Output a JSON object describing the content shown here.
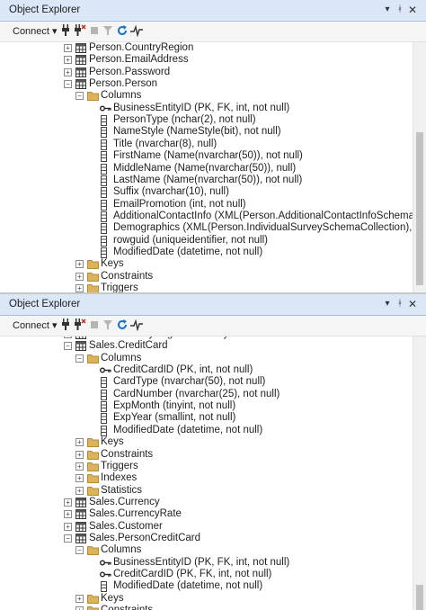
{
  "top_panel": {
    "title": "Object Explorer",
    "connect_label": "Connect",
    "tree": [
      {
        "depth": 0,
        "expander": "+",
        "icon": "table-icon",
        "label": "Person.CountryRegion"
      },
      {
        "depth": 0,
        "expander": "+",
        "icon": "table-icon",
        "label": "Person.EmailAddress"
      },
      {
        "depth": 0,
        "expander": "+",
        "icon": "table-icon",
        "label": "Person.Password"
      },
      {
        "depth": 0,
        "expander": "-",
        "icon": "table-icon",
        "label": "Person.Person"
      },
      {
        "depth": 1,
        "expander": "-",
        "icon": "folder-icon",
        "label": "Columns"
      },
      {
        "depth": 2,
        "expander": "",
        "icon": "key-icon",
        "label": "BusinessEntityID (PK, FK, int, not null)"
      },
      {
        "depth": 2,
        "expander": "",
        "icon": "column-icon",
        "label": "PersonType (nchar(2), not null)"
      },
      {
        "depth": 2,
        "expander": "",
        "icon": "column-icon",
        "label": "NameStyle (NameStyle(bit), not null)"
      },
      {
        "depth": 2,
        "expander": "",
        "icon": "column-icon",
        "label": "Title (nvarchar(8), null)"
      },
      {
        "depth": 2,
        "expander": "",
        "icon": "column-icon",
        "label": "FirstName (Name(nvarchar(50)), not null)"
      },
      {
        "depth": 2,
        "expander": "",
        "icon": "column-icon",
        "label": "MiddleName (Name(nvarchar(50)), null)"
      },
      {
        "depth": 2,
        "expander": "",
        "icon": "column-icon",
        "label": "LastName (Name(nvarchar(50)), not null)"
      },
      {
        "depth": 2,
        "expander": "",
        "icon": "column-icon",
        "label": "Suffix (nvarchar(10), null)"
      },
      {
        "depth": 2,
        "expander": "",
        "icon": "column-icon",
        "label": "EmailPromotion (int, not null)"
      },
      {
        "depth": 2,
        "expander": "",
        "icon": "column-icon",
        "label": "AdditionalContactInfo (XML(Person.AdditionalContactInfoSchemaCollection), nu"
      },
      {
        "depth": 2,
        "expander": "",
        "icon": "column-icon",
        "label": "Demographics (XML(Person.IndividualSurveySchemaCollection), null)"
      },
      {
        "depth": 2,
        "expander": "",
        "icon": "column-icon",
        "label": "rowguid (uniqueidentifier, not null)"
      },
      {
        "depth": 2,
        "expander": "",
        "icon": "column-icon",
        "label": "ModifiedDate (datetime, not null)"
      },
      {
        "depth": 1,
        "expander": "+",
        "icon": "folder-icon",
        "label": "Keys"
      },
      {
        "depth": 1,
        "expander": "+",
        "icon": "folder-icon",
        "label": "Constraints"
      },
      {
        "depth": 1,
        "expander": "+",
        "icon": "folder-icon",
        "label": "Triggers"
      }
    ]
  },
  "bottom_panel": {
    "title": "Object Explorer",
    "connect_label": "Connect",
    "tree": [
      {
        "depth": 0,
        "expander": "+",
        "icon": "table-icon",
        "label": "Sales.CountryRegionCurrency"
      },
      {
        "depth": 0,
        "expander": "-",
        "icon": "table-icon",
        "label": "Sales.CreditCard"
      },
      {
        "depth": 1,
        "expander": "-",
        "icon": "folder-icon",
        "label": "Columns"
      },
      {
        "depth": 2,
        "expander": "",
        "icon": "key-icon",
        "label": "CreditCardID (PK, int, not null)"
      },
      {
        "depth": 2,
        "expander": "",
        "icon": "column-icon",
        "label": "CardType (nvarchar(50), not null)"
      },
      {
        "depth": 2,
        "expander": "",
        "icon": "column-icon",
        "label": "CardNumber (nvarchar(25), not null)"
      },
      {
        "depth": 2,
        "expander": "",
        "icon": "column-icon",
        "label": "ExpMonth (tinyint, not null)"
      },
      {
        "depth": 2,
        "expander": "",
        "icon": "column-icon",
        "label": "ExpYear (smallint, not null)"
      },
      {
        "depth": 2,
        "expander": "",
        "icon": "column-icon",
        "label": "ModifiedDate (datetime, not null)"
      },
      {
        "depth": 1,
        "expander": "+",
        "icon": "folder-icon",
        "label": "Keys"
      },
      {
        "depth": 1,
        "expander": "+",
        "icon": "folder-icon",
        "label": "Constraints"
      },
      {
        "depth": 1,
        "expander": "+",
        "icon": "folder-icon",
        "label": "Triggers"
      },
      {
        "depth": 1,
        "expander": "+",
        "icon": "folder-icon",
        "label": "Indexes"
      },
      {
        "depth": 1,
        "expander": "+",
        "icon": "folder-icon",
        "label": "Statistics"
      },
      {
        "depth": 0,
        "expander": "+",
        "icon": "table-icon",
        "label": "Sales.Currency"
      },
      {
        "depth": 0,
        "expander": "+",
        "icon": "table-icon",
        "label": "Sales.CurrencyRate"
      },
      {
        "depth": 0,
        "expander": "+",
        "icon": "table-icon",
        "label": "Sales.Customer"
      },
      {
        "depth": 0,
        "expander": "-",
        "icon": "table-icon",
        "label": "Sales.PersonCreditCard"
      },
      {
        "depth": 1,
        "expander": "-",
        "icon": "folder-icon",
        "label": "Columns"
      },
      {
        "depth": 2,
        "expander": "",
        "icon": "key-icon",
        "label": "BusinessEntityID (PK, FK, int, not null)"
      },
      {
        "depth": 2,
        "expander": "",
        "icon": "key-icon",
        "label": "CreditCardID (PK, FK, int, not null)"
      },
      {
        "depth": 2,
        "expander": "",
        "icon": "column-icon",
        "label": "ModifiedDate (datetime, not null)"
      },
      {
        "depth": 1,
        "expander": "+",
        "icon": "folder-icon",
        "label": "Keys"
      },
      {
        "depth": 1,
        "expander": "+",
        "icon": "folder-icon",
        "label": "Constraints"
      }
    ]
  },
  "colors": {
    "titlebar_bg": "#dbe6f7",
    "folder": "#dcb35c",
    "refresh": "#1a73c8"
  }
}
